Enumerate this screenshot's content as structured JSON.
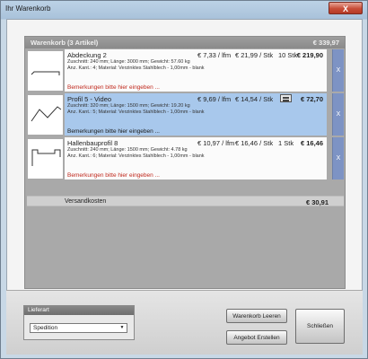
{
  "window": {
    "title": "Ihr Warenkorb",
    "close_label": "X"
  },
  "cart": {
    "header_label": "Warenkorb (3 Artikel)",
    "header_total": "€ 339,97",
    "items": [
      {
        "name": "Abdeckung 2",
        "price_lfm": "€ 7,33 / lfm",
        "price_stk": "€ 21,99 / Stk",
        "qty": "10 Stk",
        "total": "€ 219,90",
        "details1": "Zuschnitt: 240 mm; Länge: 3000 mm; Gewicht: 57.60 kg",
        "details2": "Anz. Kant.: 4; Material: Verzinktes Stahlblech - 1,00mm - blank",
        "remark": "Bemerkungen bitte hier eingeben ...",
        "remove": "X"
      },
      {
        "name": "Profil 5 - Video",
        "price_lfm": "€ 9,69 / lfm",
        "price_stk": "€ 14,54 / Stk",
        "qty": "",
        "total": "€ 72,70",
        "details1": "Zuschnitt: 320 mm; Länge: 1500 mm; Gewicht: 19.20 kg",
        "details2": "Anz. Kant.: 5; Material: Verzinktes Stahlblech - 1,00mm - blank",
        "remark": "Bemerkungen bitte hier eingeben ...",
        "remove": "X"
      },
      {
        "name": "Hallenbauprofil 8",
        "price_lfm": "€ 10,97 / lfm",
        "price_stk": "€ 16,46 / Stk",
        "qty": "1 Stk",
        "total": "€ 16,46",
        "details1": "Zuschnitt: 240 mm; Länge: 1500 mm; Gewicht: 4.78 kg",
        "details2": "Anz. Kant.: 6; Material: Verzinktes Stahlblech - 1,00mm - blank",
        "remark": "Bemerkungen bitte hier eingeben ...",
        "remove": "X"
      }
    ],
    "shipping_label": "Versandkosten",
    "shipping_value": "€ 30,91"
  },
  "delivery": {
    "title": "Lieferart",
    "selected": "Spedition"
  },
  "buttons": {
    "clear": "Warenkorb Leeren",
    "offer": "Angebot Erstellen",
    "close": "Schließen"
  }
}
